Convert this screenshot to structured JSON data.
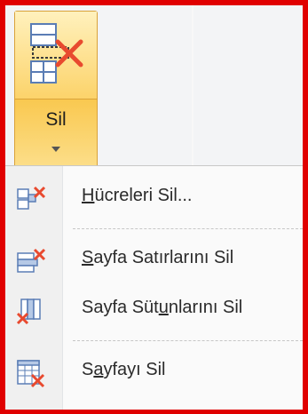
{
  "ribbon": {
    "delete_button": {
      "label": "Sil",
      "icon": "delete-cells-icon",
      "dropdown_icon": "chevron-down-icon"
    }
  },
  "menu": {
    "items": [
      {
        "label": "Hücreleri Sil...",
        "mnemonic": "H",
        "icon": "delete-cells-icon"
      },
      {
        "label": "Sayfa Satırlarını Sil",
        "mnemonic": "S",
        "icon": "delete-rows-icon"
      },
      {
        "label": "Sayfa Sütunlarını Sil",
        "mnemonic": "u",
        "icon": "delete-columns-icon"
      },
      {
        "label": "Sayfayı Sil",
        "mnemonic": "a",
        "icon": "delete-sheet-icon"
      }
    ]
  },
  "colors": {
    "frame": "#e00000",
    "button_highlight": "#fbd46e",
    "delete_x": "#e84a2f"
  }
}
